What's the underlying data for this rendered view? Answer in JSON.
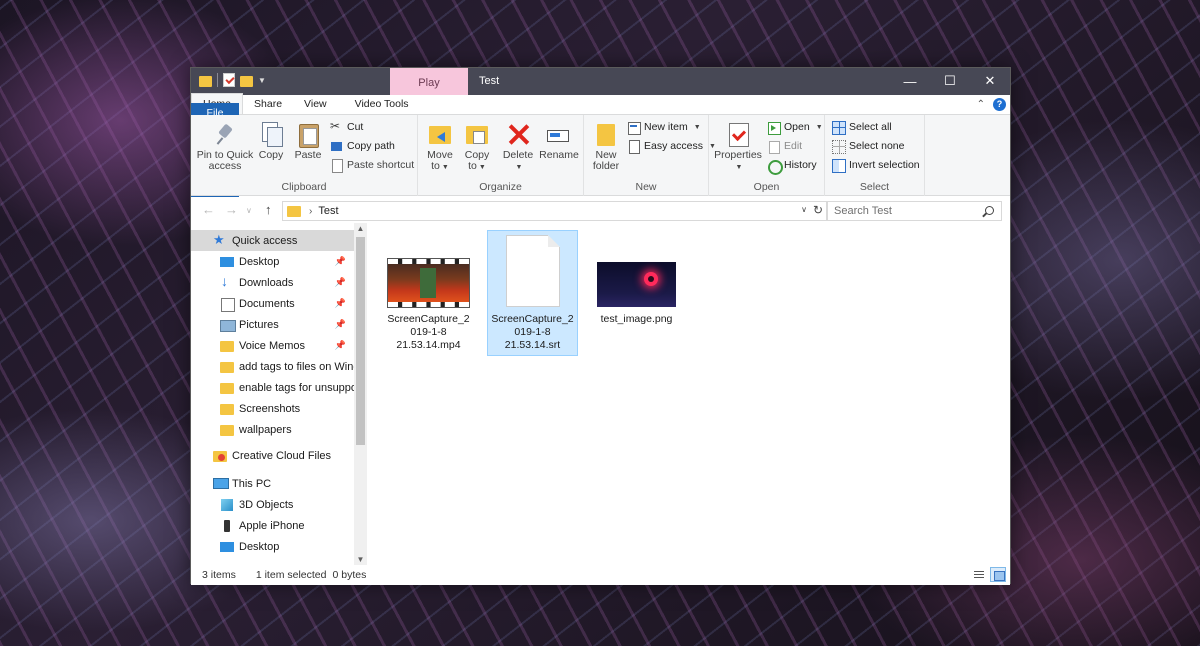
{
  "titlebar": {
    "context_tab": "Play",
    "title": "Test",
    "controls": [
      "minimize",
      "maximize",
      "close"
    ]
  },
  "tabs": {
    "file": "File",
    "home": "Home",
    "share": "Share",
    "view": "View",
    "video_tools": "Video Tools",
    "help": "?"
  },
  "ribbon": {
    "clipboard": {
      "label": "Clipboard",
      "pin_line1": "Pin to Quick",
      "pin_line2": "access",
      "copy": "Copy",
      "paste": "Paste",
      "cut": "Cut",
      "copy_path": "Copy path",
      "paste_shortcut": "Paste shortcut"
    },
    "organize": {
      "label": "Organize",
      "move_to_line1": "Move",
      "move_to_line2": "to",
      "copy_to_line1": "Copy",
      "copy_to_line2": "to",
      "delete": "Delete",
      "rename": "Rename"
    },
    "new": {
      "label": "New",
      "new_folder_line1": "New",
      "new_folder_line2": "folder",
      "new_item": "New item",
      "easy_access": "Easy access"
    },
    "open": {
      "label": "Open",
      "properties": "Properties",
      "open": "Open",
      "edit": "Edit",
      "history": "History"
    },
    "select": {
      "label": "Select",
      "select_all": "Select all",
      "select_none": "Select none",
      "invert_selection": "Invert selection"
    }
  },
  "address": {
    "crumb": "Test",
    "search_placeholder": "Search Test"
  },
  "nav": {
    "items": [
      {
        "label": "Quick access",
        "icon": "star-icon"
      },
      {
        "label": "Desktop",
        "icon": "desktop-icon"
      },
      {
        "label": "Downloads",
        "icon": "downloads-icon"
      },
      {
        "label": "Documents",
        "icon": "documents-icon"
      },
      {
        "label": "Pictures",
        "icon": "pictures-icon"
      },
      {
        "label": "Voice Memos",
        "icon": "folder-icon"
      },
      {
        "label": "add tags to files on Windo",
        "icon": "folder-icon"
      },
      {
        "label": "enable tags for unsupporte",
        "icon": "folder-icon"
      },
      {
        "label": "Screenshots",
        "icon": "folder-icon"
      },
      {
        "label": "wallpapers",
        "icon": "folder-icon"
      },
      {
        "label": "Creative Cloud Files",
        "icon": "creative-cloud-icon"
      },
      {
        "label": "This PC",
        "icon": "pc-icon"
      },
      {
        "label": "3D Objects",
        "icon": "3d-objects-icon"
      },
      {
        "label": "Apple iPhone",
        "icon": "phone-icon"
      },
      {
        "label": "Desktop",
        "icon": "desktop-icon"
      }
    ]
  },
  "files": [
    {
      "line1": "ScreenCapture_2",
      "line2": "019-1-8",
      "line3": "21.53.14.mp4",
      "kind": "video-thumbnail"
    },
    {
      "line1": "ScreenCapture_2",
      "line2": "019-1-8",
      "line3": "21.53.14.srt",
      "kind": "document-icon"
    },
    {
      "line1": "test_image.png",
      "kind": "image-thumbnail"
    }
  ],
  "status": {
    "items_count": "3 items",
    "selection": "1 item selected",
    "size": "0 bytes"
  },
  "colors": {
    "accent": "#1e65b5",
    "titlebar": "#474855",
    "context_tab": "#f7c6dc",
    "selection": "#cce8ff"
  }
}
